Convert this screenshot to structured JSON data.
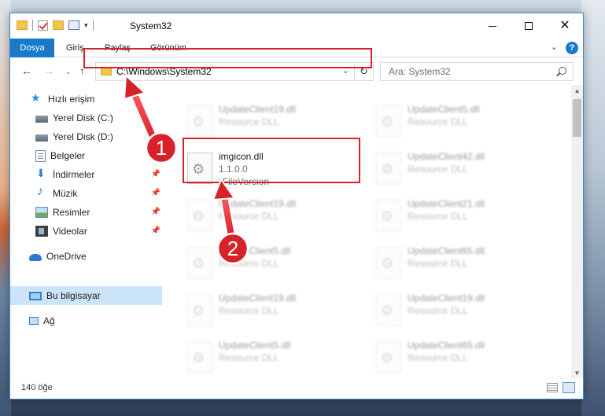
{
  "window": {
    "title": "System32",
    "controls": {
      "minimize": "minimize-icon",
      "maximize": "maximize-icon",
      "close": "close-icon"
    }
  },
  "ribbon": {
    "tabs": [
      {
        "label": "Dosya",
        "active": true
      },
      {
        "label": "Giriş"
      },
      {
        "label": "Paylaş"
      },
      {
        "label": "Görünüm"
      }
    ],
    "help": "?",
    "expand_icon": "chevron-down-icon"
  },
  "address": {
    "path": "C:\\Windows\\System32",
    "refresh_icon": "refresh-icon"
  },
  "search": {
    "placeholder": "Ara: System32"
  },
  "navpane": {
    "items": [
      {
        "label": "Hızlı erişim",
        "icon": "star-icon"
      },
      {
        "label": "Yerel Disk (C:)",
        "icon": "disk-icon"
      },
      {
        "label": "Yerel Disk (D:)",
        "icon": "disk-icon"
      },
      {
        "label": "Belgeler",
        "icon": "documents-icon",
        "pinned": true
      },
      {
        "label": "İndirmeler",
        "icon": "downloads-icon",
        "pinned": true
      },
      {
        "label": "Müzik",
        "icon": "music-icon",
        "pinned": true
      },
      {
        "label": "Resimler",
        "icon": "pictures-icon",
        "pinned": true
      },
      {
        "label": "Videolar",
        "icon": "videos-icon",
        "pinned": true
      },
      {
        "label": "OneDrive",
        "icon": "cloud-icon"
      },
      {
        "label": "Bu bilgisayar",
        "icon": "computer-icon",
        "selected": true
      },
      {
        "label": "Ağ",
        "icon": "network-icon"
      }
    ]
  },
  "files": {
    "col1": [
      {
        "name": "UpdateClient19.dll",
        "type": "Resource DLL"
      },
      {
        "name": "imgicon.dll",
        "version": "1.1.0.0",
        "desc": "*FileVersion"
      },
      {
        "name": "UpdateClient19.dll",
        "type": "Resource DLL"
      },
      {
        "name": "UpdateClient5.dll",
        "type": "Resource DLL"
      },
      {
        "name": "UpdateClient19.dll",
        "type": "Resource DLL"
      },
      {
        "name": "UpdateClient5.dll",
        "type": "Resource DLL"
      }
    ],
    "col2": [
      {
        "name": "UpdateClient5.dll",
        "type": "Resource DLL"
      },
      {
        "name": "UpdateClient42.dll",
        "type": "Resource DLL"
      },
      {
        "name": "UpdateClient21.dll",
        "type": "Resource DLL"
      },
      {
        "name": "UpdateClient65.dll",
        "type": "Resource DLL"
      },
      {
        "name": "UpdateClient19.dll",
        "type": "Resource DLL"
      },
      {
        "name": "UpdateClient65.dll",
        "type": "Resource DLL"
      }
    ]
  },
  "status": {
    "count": "140 öğe"
  },
  "annotations": {
    "step1": "1",
    "step2": "2",
    "highlight_color": "#d7222a"
  }
}
